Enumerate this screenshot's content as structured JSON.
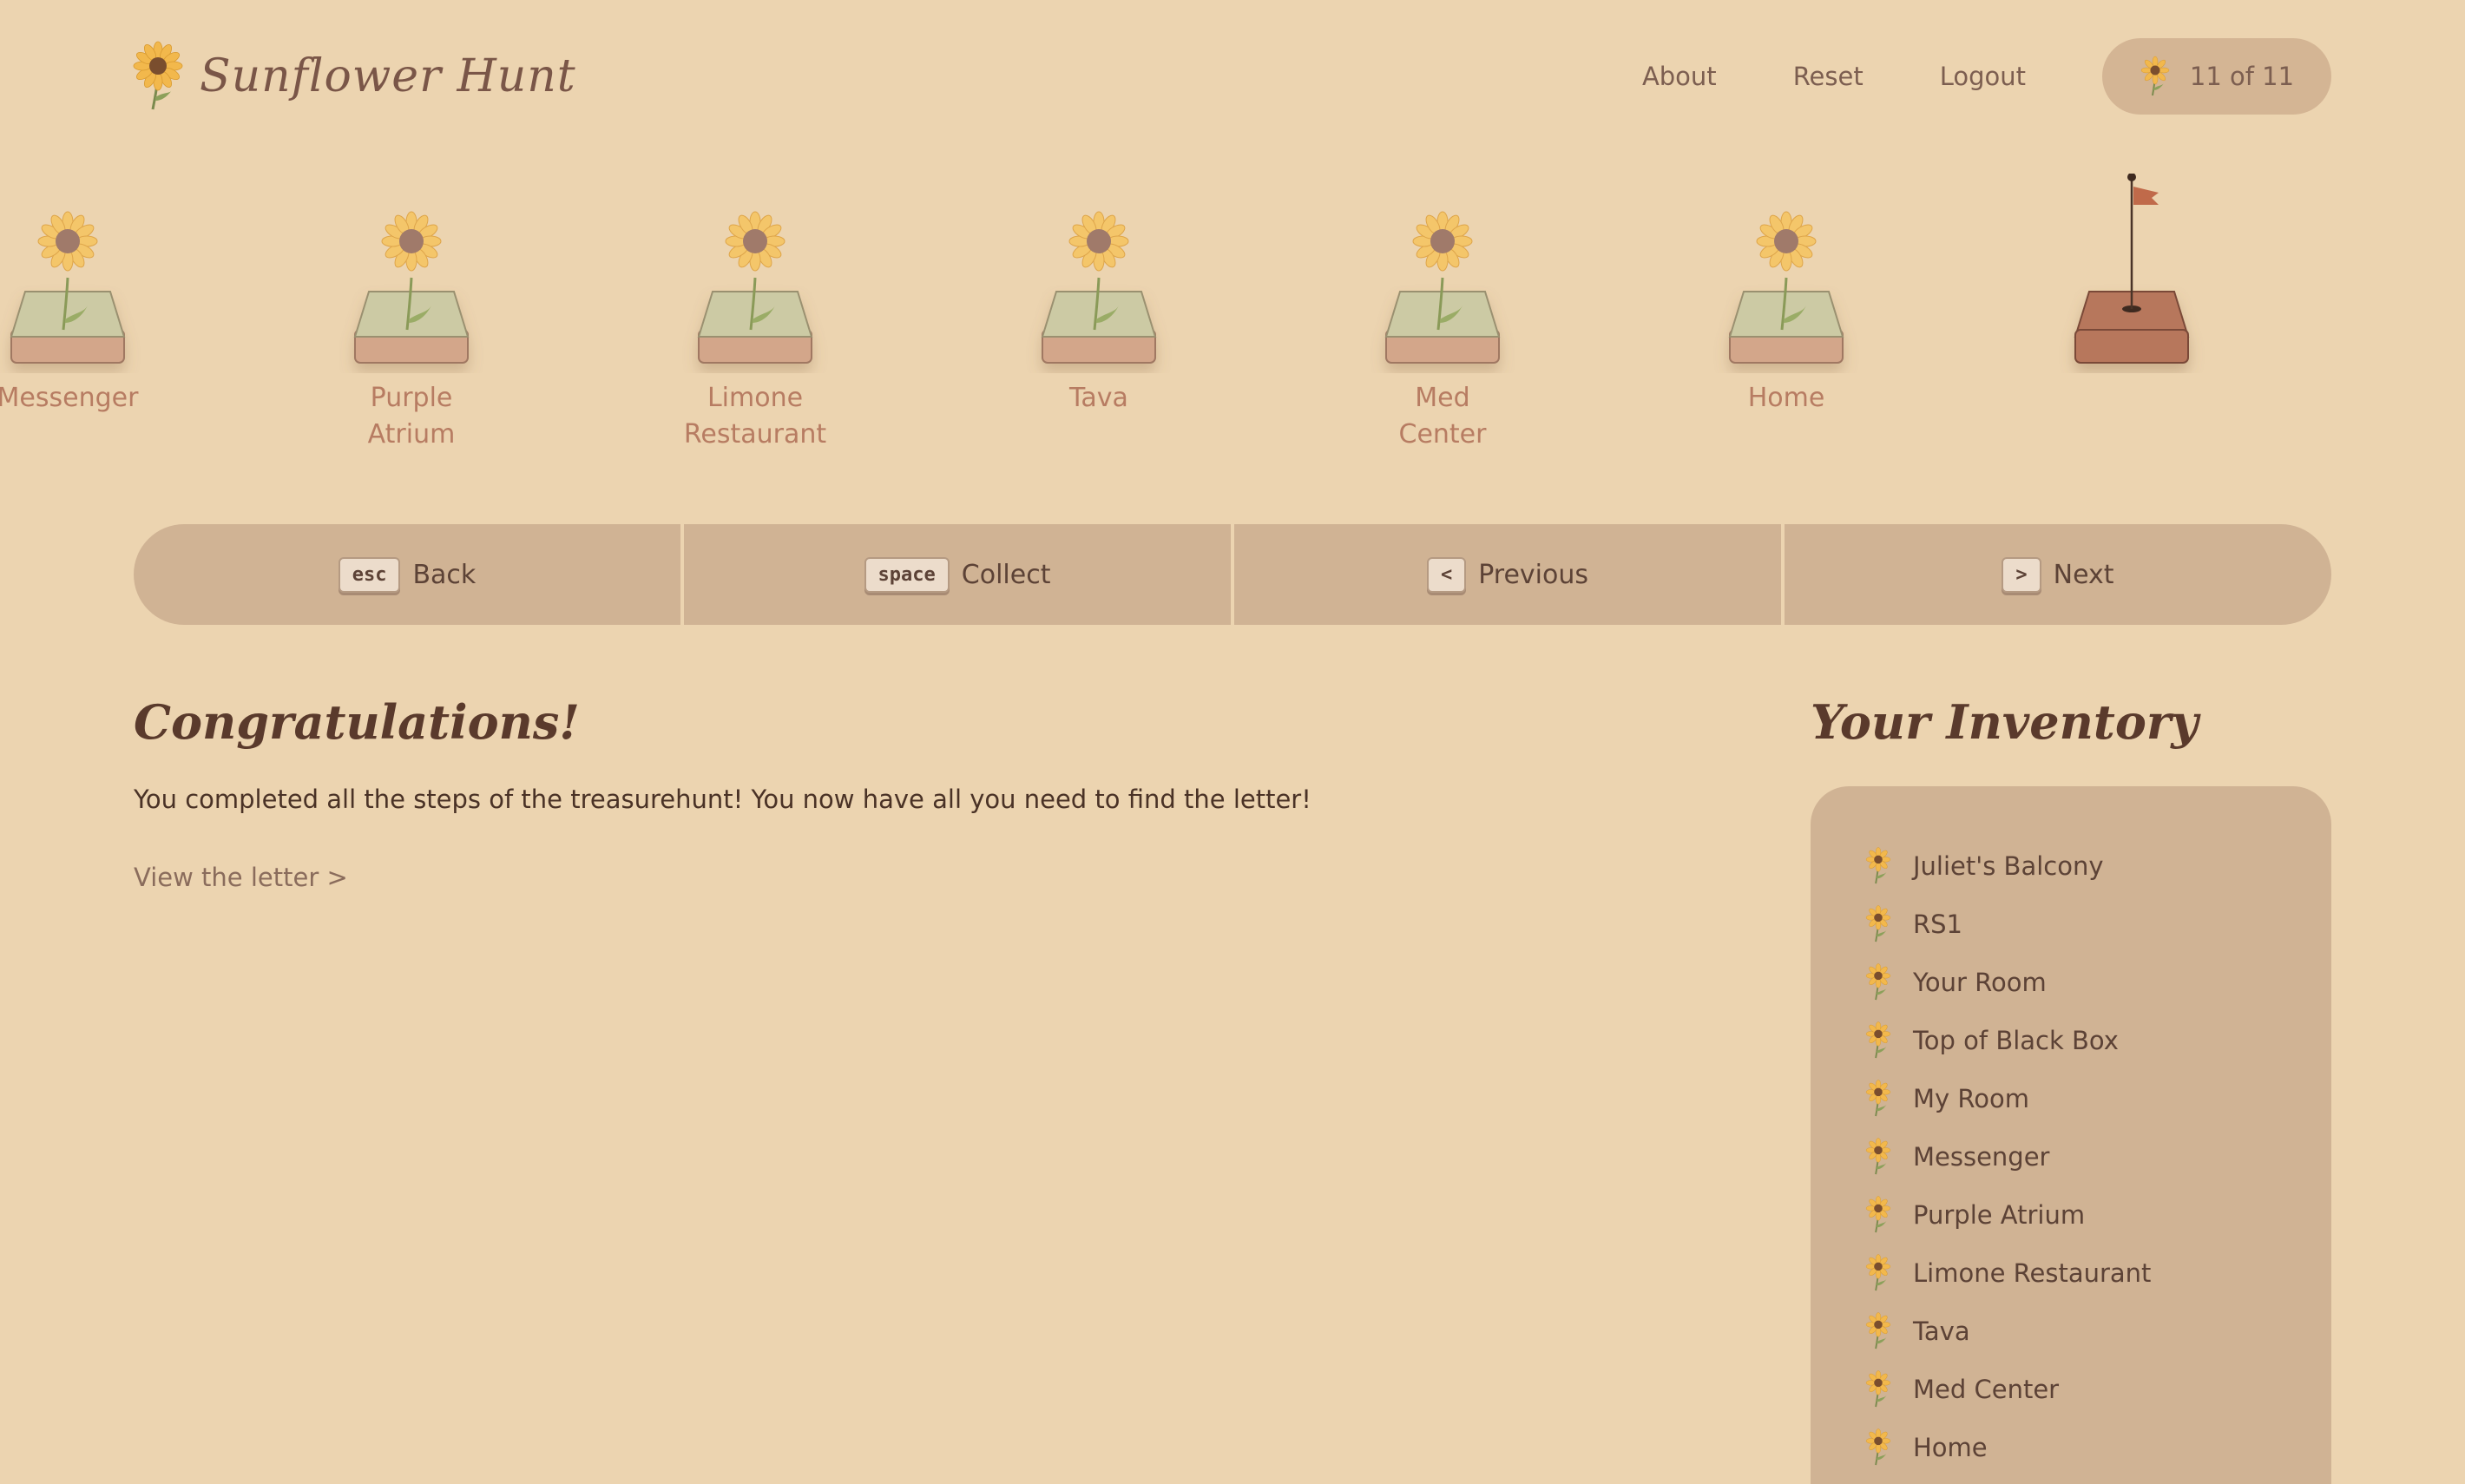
{
  "header": {
    "app_title": "Sunflower Hunt",
    "nav": [
      "About",
      "Reset",
      "Logout"
    ],
    "progress_text": "11 of 11"
  },
  "steps": [
    {
      "label": "Messenger"
    },
    {
      "label": "Purple\nAtrium"
    },
    {
      "label": "Limone\nRestaurant"
    },
    {
      "label": "Tava"
    },
    {
      "label": "Med\nCenter"
    },
    {
      "label": "Home"
    }
  ],
  "controls": [
    {
      "key": "esc",
      "label": "Back"
    },
    {
      "key": "space",
      "label": "Collect"
    },
    {
      "key": "<",
      "label": "Previous"
    },
    {
      "key": ">",
      "label": "Next"
    }
  ],
  "main": {
    "title": "Congratulations!",
    "text": "You completed all the steps of the treasurehunt! You now have all you need to find the letter!",
    "link": "View the letter >"
  },
  "inventory": {
    "title": "Your Inventory",
    "items": [
      "Juliet's Balcony",
      "RS1",
      "Your Room",
      "Top of Black Box",
      "My Room",
      "Messenger",
      "Purple Atrium",
      "Limone Restaurant",
      "Tava",
      "Med Center",
      "Home"
    ]
  },
  "colors": {
    "background": "#ecd4b0",
    "panel": "#d0b394",
    "accent_text": "#b77c62",
    "flag": "#c06a4a"
  },
  "icons": {
    "logo": "sunflower-icon",
    "progress": "sunflower-icon",
    "final_step": "flag-icon"
  }
}
